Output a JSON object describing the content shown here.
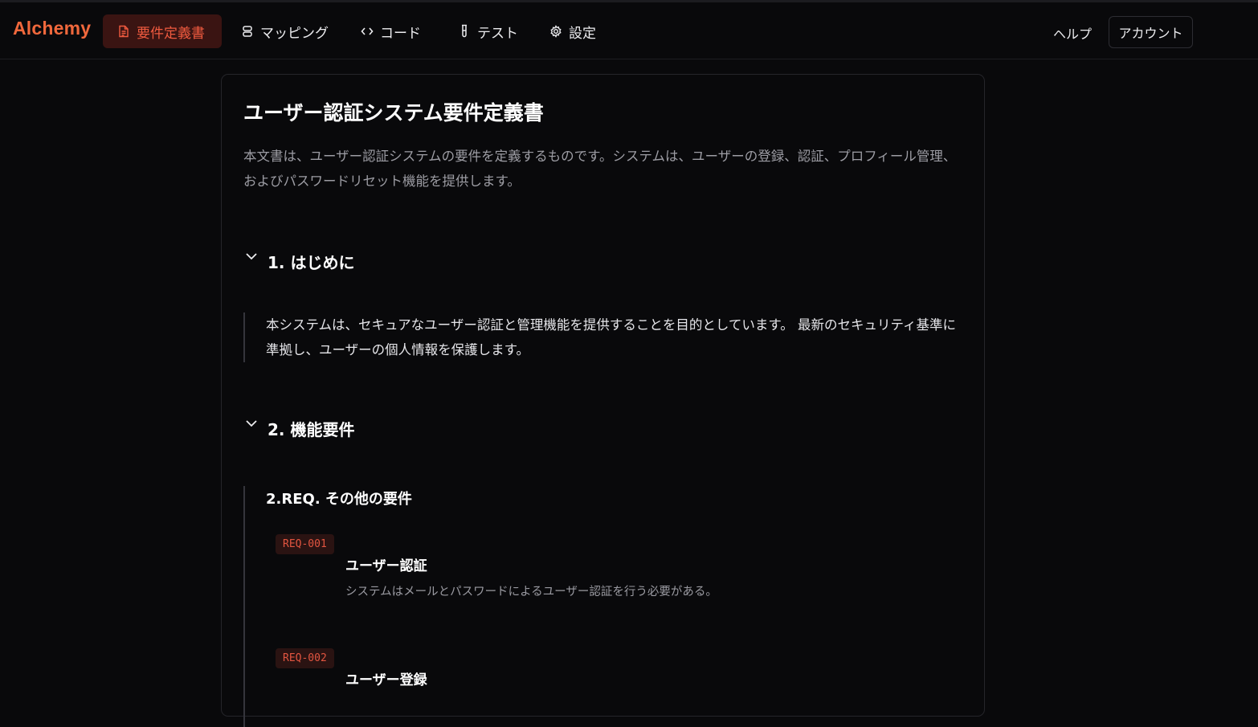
{
  "app": {
    "logo": "Alchemy"
  },
  "nav": {
    "items": [
      {
        "label": "要件定義書",
        "icon": "document-icon",
        "active": true
      },
      {
        "label": "マッピング",
        "icon": "link-icon",
        "active": false
      },
      {
        "label": "コード",
        "icon": "code-icon",
        "active": false
      },
      {
        "label": "テスト",
        "icon": "test-tube-icon",
        "active": false
      },
      {
        "label": "設定",
        "icon": "gear-icon",
        "active": false
      }
    ],
    "help": "ヘルプ",
    "account": "アカウント"
  },
  "document": {
    "title": "ユーザー認証システム要件定義書",
    "description": "本文書は、ユーザー認証システムの要件を定義するものです。システムは、ユーザーの登録、認証、プロフィール管理、およびパスワードリセット機能を提供します。",
    "sections": [
      {
        "title": "1. はじめに",
        "text": "本システムは、セキュアなユーザー認証と管理機能を提供することを目的としています。 最新のセキュリティ基準に準拠し、ユーザーの個人情報を保護します。"
      },
      {
        "title": "2. 機能要件",
        "subsection_title": "2.REQ. その他の要件",
        "requirements": [
          {
            "id": "REQ-001",
            "title": "ユーザー認証",
            "description": "システムはメールとパスワードによるユーザー認証を行う必要がある。"
          },
          {
            "id": "REQ-002",
            "title": "ユーザー登録",
            "description": ""
          }
        ]
      }
    ]
  },
  "colors": {
    "background": "#09090b",
    "accent": "#f0683c",
    "active_nav_bg": "#3a1412",
    "active_nav_text": "#ef5a3f",
    "req_badge_bg": "#2a1312",
    "req_badge_text": "#e25540"
  }
}
